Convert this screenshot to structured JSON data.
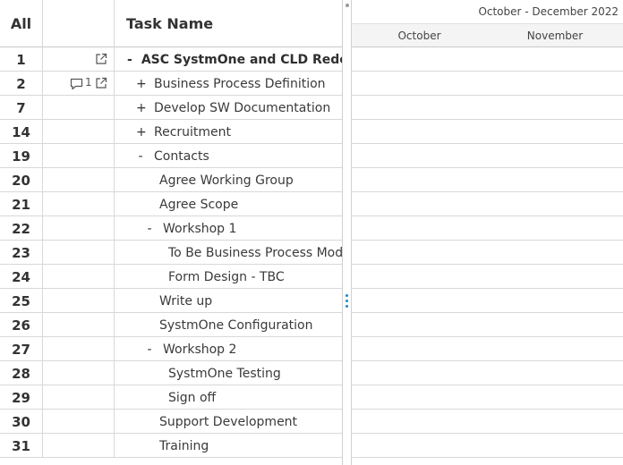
{
  "header": {
    "all_label": "All",
    "task_name_label": "Task Name"
  },
  "timeline": {
    "range_label": "October - December 2022",
    "months": [
      "October",
      "November"
    ]
  },
  "rows": [
    {
      "num": "1",
      "name": "ASC SystmOne and CLD Redesign",
      "toggle": "-",
      "level": 0,
      "bold": true,
      "comments": "",
      "external_link": true
    },
    {
      "num": "2",
      "name": "Business Process Definition",
      "toggle": "+",
      "level": 1,
      "bold": false,
      "comments": "1",
      "external_link": true
    },
    {
      "num": "7",
      "name": "Develop SW Documentation",
      "toggle": "+",
      "level": 1,
      "bold": false,
      "comments": "",
      "external_link": false
    },
    {
      "num": "14",
      "name": "Recruitment",
      "toggle": "+",
      "level": 1,
      "bold": false,
      "comments": "",
      "external_link": false
    },
    {
      "num": "19",
      "name": "Contacts",
      "toggle": "-",
      "level": 1,
      "bold": false,
      "comments": "",
      "external_link": false
    },
    {
      "num": "20",
      "name": "Agree Working Group",
      "toggle": "",
      "level": 2,
      "bold": false,
      "comments": "",
      "external_link": false
    },
    {
      "num": "21",
      "name": "Agree Scope",
      "toggle": "",
      "level": 2,
      "bold": false,
      "comments": "",
      "external_link": false
    },
    {
      "num": "22",
      "name": "Workshop 1",
      "toggle": "-",
      "level": 2,
      "bold": false,
      "comments": "",
      "external_link": false
    },
    {
      "num": "23",
      "name": "To Be Business Process Mod",
      "toggle": "",
      "level": 3,
      "bold": false,
      "comments": "",
      "external_link": false
    },
    {
      "num": "24",
      "name": "Form Design - TBC",
      "toggle": "",
      "level": 3,
      "bold": false,
      "comments": "",
      "external_link": false
    },
    {
      "num": "25",
      "name": "Write up",
      "toggle": "",
      "level": 2,
      "bold": false,
      "comments": "",
      "external_link": false
    },
    {
      "num": "26",
      "name": "SystmOne Configuration",
      "toggle": "",
      "level": 2,
      "bold": false,
      "comments": "",
      "external_link": false
    },
    {
      "num": "27",
      "name": "Workshop 2",
      "toggle": "-",
      "level": 2,
      "bold": false,
      "comments": "",
      "external_link": false
    },
    {
      "num": "28",
      "name": "SystmOne Testing",
      "toggle": "",
      "level": 3,
      "bold": false,
      "comments": "",
      "external_link": false
    },
    {
      "num": "29",
      "name": "Sign off",
      "toggle": "",
      "level": 3,
      "bold": false,
      "comments": "",
      "external_link": false
    },
    {
      "num": "30",
      "name": "Support Development",
      "toggle": "",
      "level": 2,
      "bold": false,
      "comments": "",
      "external_link": false
    },
    {
      "num": "31",
      "name": "Training",
      "toggle": "",
      "level": 2,
      "bold": false,
      "comments": "",
      "external_link": false
    }
  ],
  "icons": {
    "external_link": "external-link-icon",
    "comment": "comment-icon"
  }
}
